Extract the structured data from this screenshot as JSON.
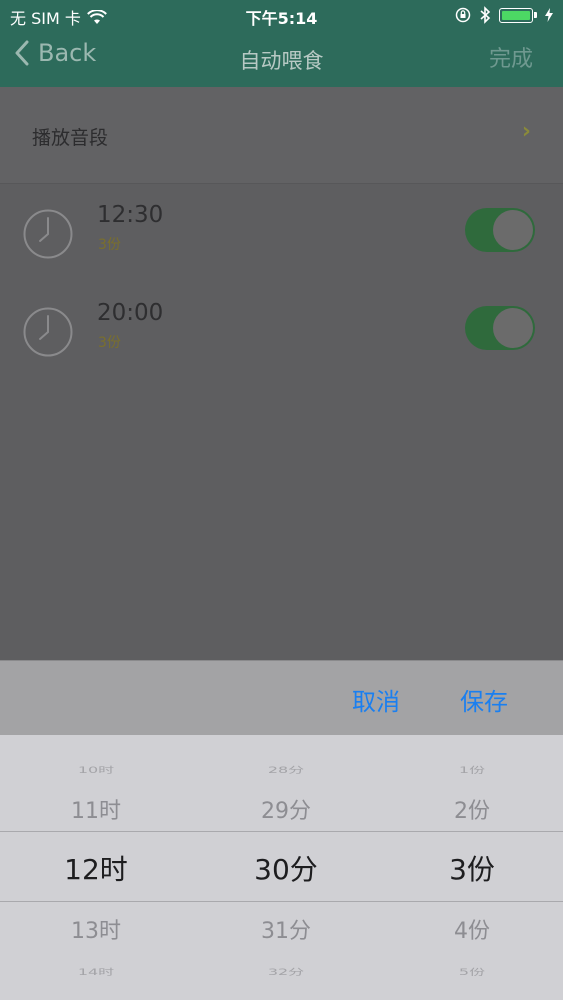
{
  "status": {
    "carrier": "无 SIM 卡",
    "time": "下午5:14"
  },
  "nav": {
    "back_label": "Back",
    "title": "自动喂食",
    "done_label": "完成"
  },
  "sound_row": {
    "label": "播放音段",
    "chevron": "›"
  },
  "alarms": [
    {
      "time": "12:30",
      "portion": "3份",
      "enabled": true
    },
    {
      "time": "20:00",
      "portion": "3份",
      "enabled": true
    }
  ],
  "sheet": {
    "cancel_label": "取消",
    "save_label": "保存"
  },
  "picker": {
    "hours": [
      "10时",
      "11时",
      "12时",
      "13时",
      "14时"
    ],
    "minutes": [
      "28分",
      "29分",
      "30分",
      "31分",
      "32分"
    ],
    "portions": [
      "1份",
      "2份",
      "3份",
      "4份",
      "5份"
    ],
    "selected": {
      "hour": "12时",
      "minute": "30分",
      "portion": "3份"
    }
  },
  "colors": {
    "accent": "#1a7ff0",
    "nav": "#2d6b5b",
    "toggle_on": "#2f6a3c"
  },
  "icons": {
    "back": "chevron-left-icon",
    "wifi": "wifi-icon",
    "bluetooth": "bluetooth-icon",
    "battery": "battery-icon",
    "lock": "orientation-lock-icon",
    "clock": "clock-icon"
  }
}
